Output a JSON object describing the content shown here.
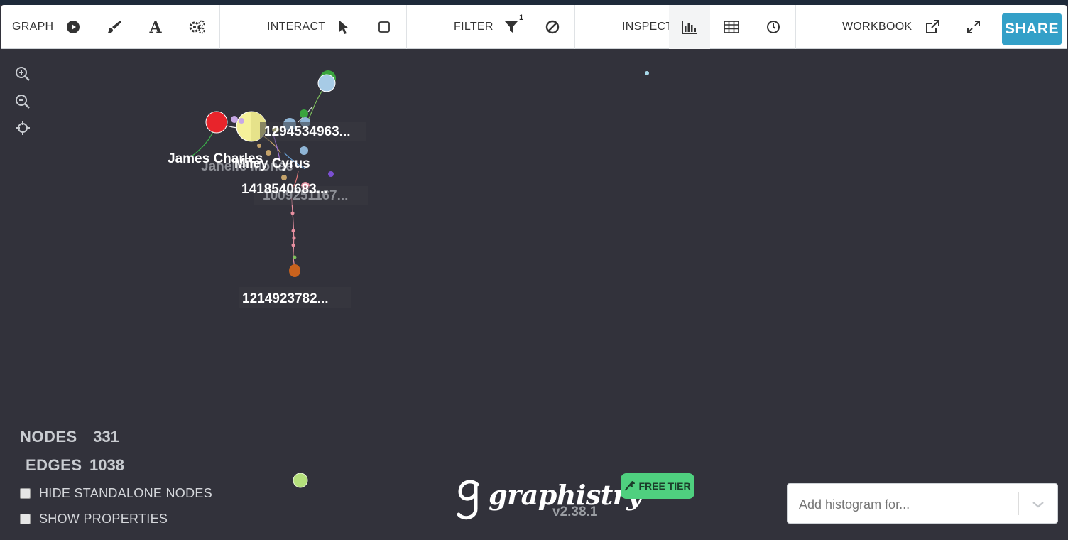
{
  "toolbar": {
    "graph_label": "GRAPH",
    "interact_label": "INTERACT",
    "filter_label": "FILTER",
    "filter_badge": "1",
    "inspect_label": "INSPECT",
    "workbook_label": "WORKBOOK",
    "share_label": "SHARE",
    "icons": {
      "graph": [
        "play-icon",
        "brush-icon",
        "font-icon",
        "gears-icon"
      ],
      "interact": [
        "pointer-icon",
        "square-select-icon"
      ],
      "filter": [
        "filter-icon",
        "ban-icon"
      ],
      "inspect": [
        "histogram-icon",
        "table-icon",
        "clock-icon"
      ],
      "workbook": [
        "external-link-icon",
        "expand-icon"
      ]
    }
  },
  "graph": {
    "labels": [
      "1294534963...",
      "James Charles",
      "Janelle Monáe",
      "Miley Cyrus",
      "1418540683...",
      "1009251167...",
      "1214923782..."
    ]
  },
  "stats": {
    "nodes_label": "NODES",
    "nodes_value": "331",
    "edges_label": "EDGES",
    "edges_value": "1038"
  },
  "options": {
    "hide_standalone": "HIDE STANDALONE NODES",
    "show_properties": "SHOW PROPERTIES"
  },
  "brand": {
    "logo_text": "graphistry",
    "version": "v2.38.1",
    "free_tier": "FREE TIER"
  },
  "histogram": {
    "placeholder": "Add histogram for..."
  },
  "colors": {
    "background": "#32323b",
    "share": "#33a0c8",
    "free_tier": "#4fd07f"
  }
}
